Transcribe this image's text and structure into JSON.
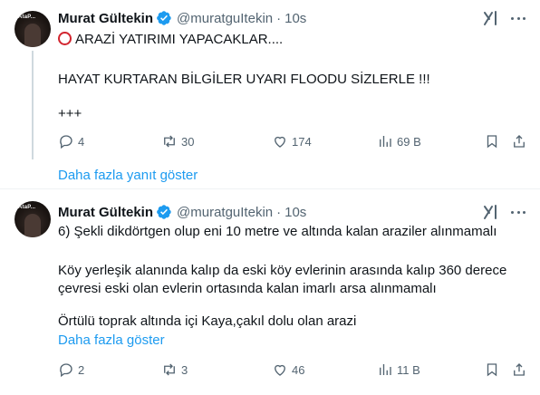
{
  "tweets": [
    {
      "author": {
        "name": "Murat Gültekin",
        "handle": "@muratguItekin",
        "time": "10s",
        "avatar_tag": "AtaP..."
      },
      "lines": [
        "ARAZİ YATIRIMI YAPACAKLAR....",
        "HAYAT KURTARAN BİLGİLER UYARI FLOODU SİZLERLE !!!",
        "+++"
      ],
      "lead_icon": "red-circle-icon",
      "stats": {
        "replies": "4",
        "reposts": "30",
        "likes": "174",
        "views": "69 B"
      }
    },
    {
      "author": {
        "name": "Murat Gültekin",
        "handle": "@muratguItekin",
        "time": "10s",
        "avatar_tag": "AtaP..."
      },
      "lines": [
        "6) Şekli dikdörtgen olup eni 10 metre ve altında kalan araziler alınmamalı",
        "Köy yerleşik alanında kalıp da eski köy evlerinin arasında kalıp 360 derece",
        "çevresi eski olan evlerin ortasında kalan imarlı arsa alınmamalı",
        "Örtülü toprak altında içi Kaya,çakıl dolu olan arazi"
      ],
      "show_more": "Daha fazla göster",
      "stats": {
        "replies": "2",
        "reposts": "3",
        "likes": "46",
        "views": "11 B"
      }
    }
  ],
  "show_more_replies": "Daha fazla yanıt göster",
  "colors": {
    "link": "#1d9bf0",
    "secondary": "#536471",
    "verified": "#1d9bf0",
    "emoji_red": "#d2252f"
  }
}
